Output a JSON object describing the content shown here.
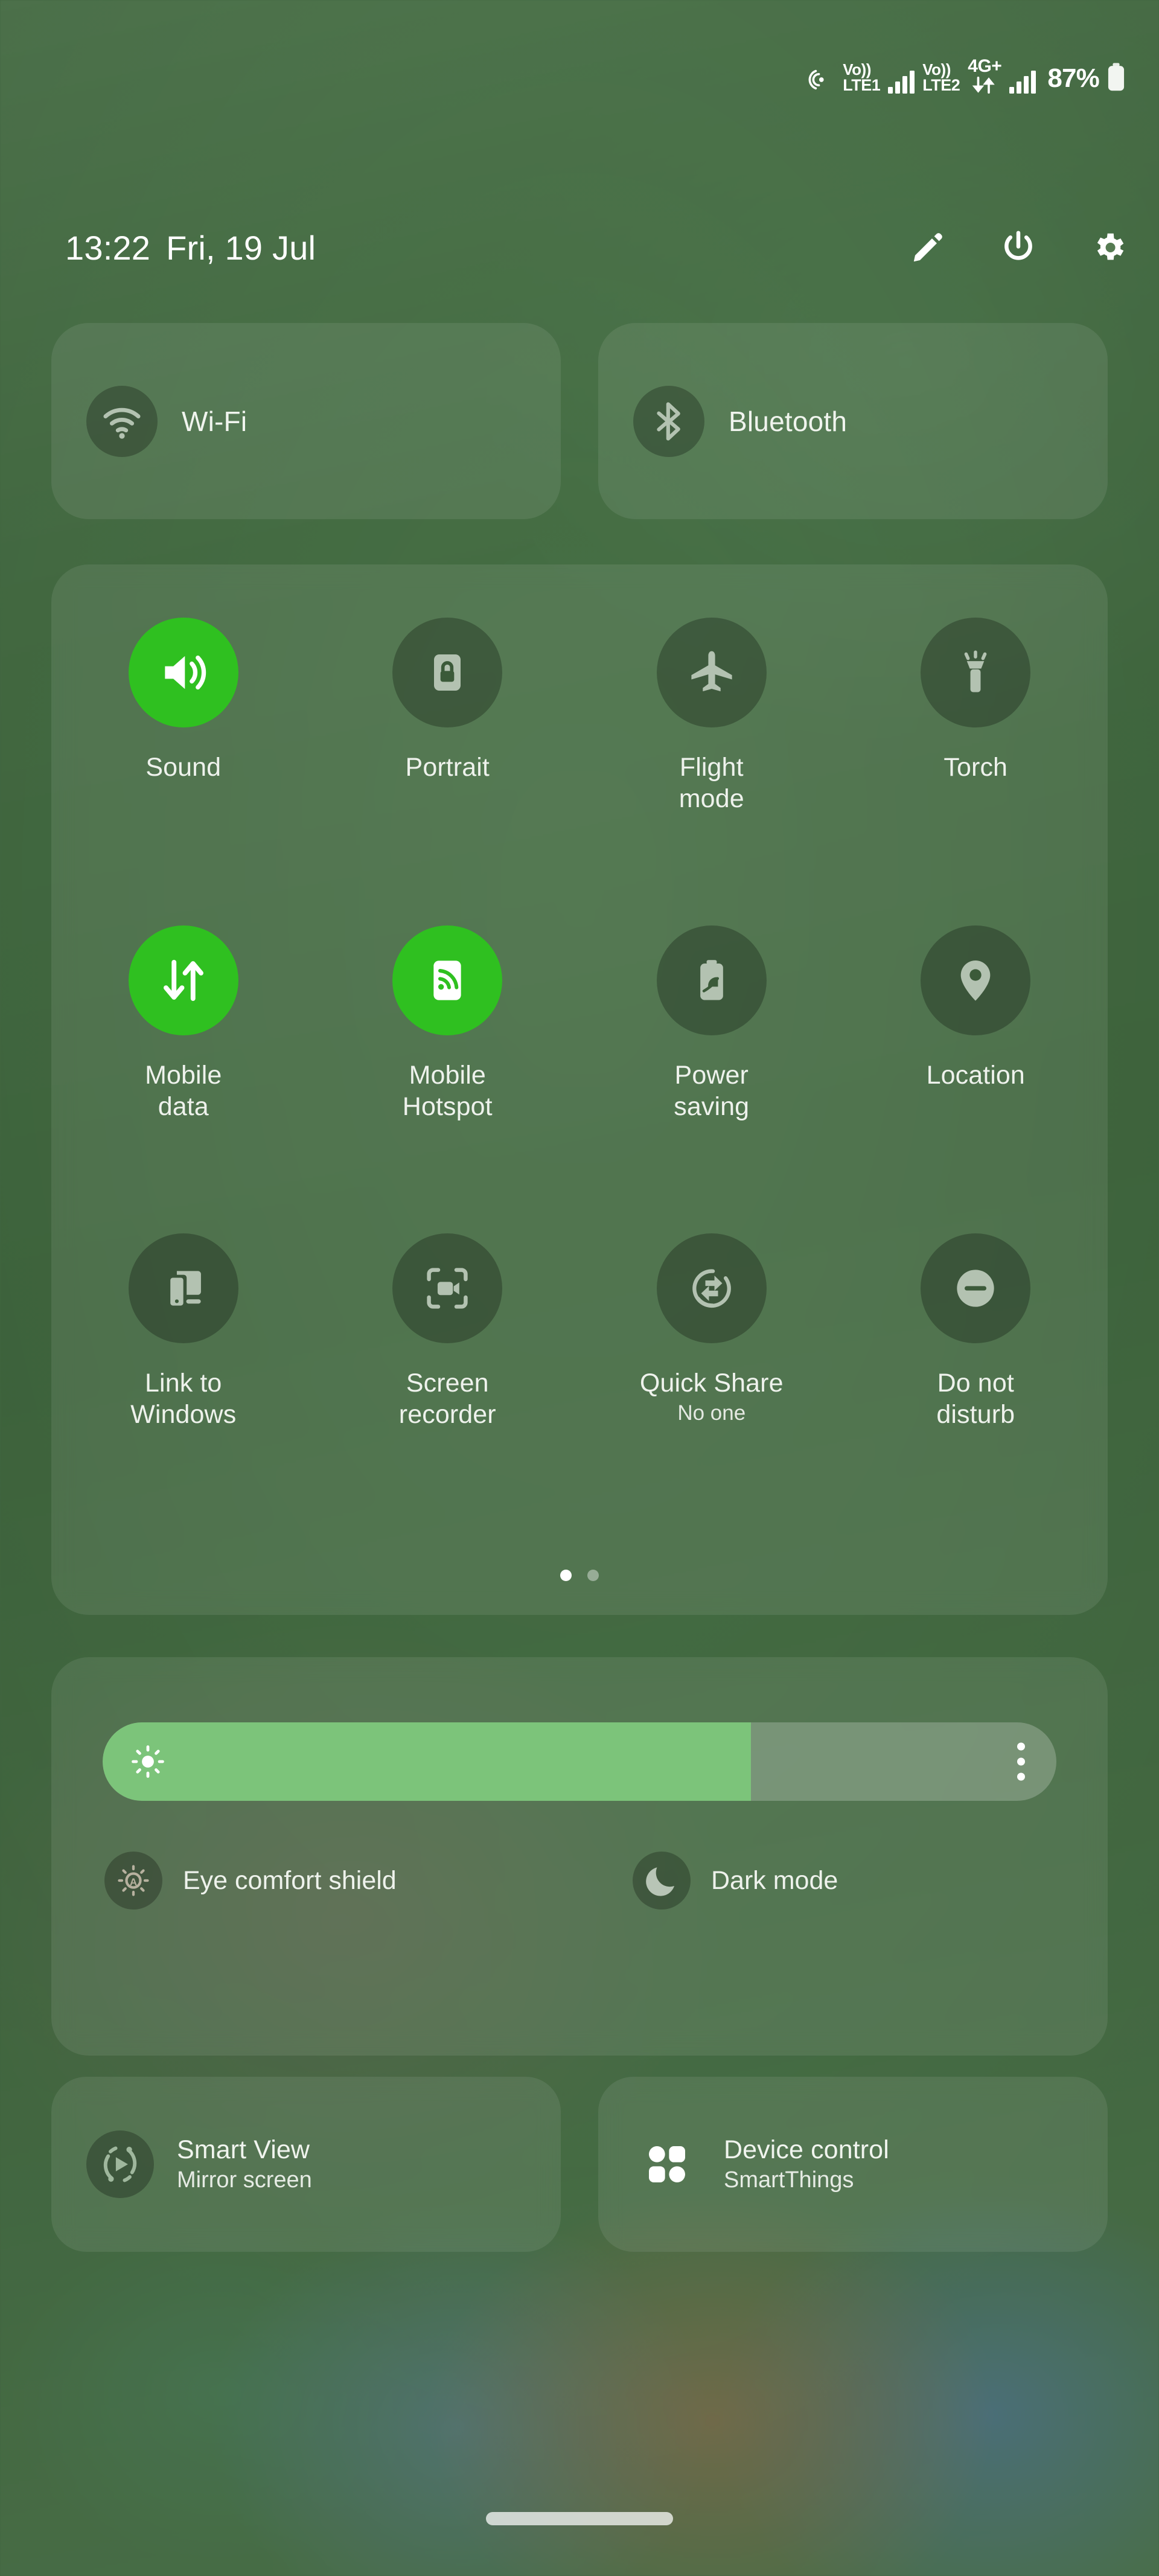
{
  "status_bar": {
    "hotspot_icon": "hotspot-icon",
    "sim1": {
      "volte_top": "Vo))",
      "volte_bottom": "LTE1",
      "signal_icon": "signal-bars-icon"
    },
    "sim2": {
      "volte_top": "Vo))",
      "volte_bottom": "LTE2",
      "network": "4G+",
      "data_arrows_icon": "data-transfer-icon",
      "signal_icon": "signal-bars-icon"
    },
    "battery_percent": "87%",
    "battery_icon": "battery-icon"
  },
  "header": {
    "time": "13:22",
    "date": "Fri, 19 Jul",
    "icons": [
      {
        "name": "edit-icon",
        "label": "Edit"
      },
      {
        "name": "power-icon",
        "label": "Power"
      },
      {
        "name": "settings-gear-icon",
        "label": "Settings"
      }
    ]
  },
  "top_tiles": [
    {
      "label": "Wi-Fi",
      "icon": "wifi-icon",
      "active": false
    },
    {
      "label": "Bluetooth",
      "icon": "bluetooth-icon",
      "active": false
    }
  ],
  "quick_toggles": [
    {
      "label": "Sound",
      "icon": "volume-on-icon",
      "active": true,
      "sub": ""
    },
    {
      "label": "Portrait",
      "icon": "rotation-lock-icon",
      "active": false,
      "sub": ""
    },
    {
      "label": "Flight\nmode",
      "icon": "airplane-icon",
      "active": false,
      "sub": ""
    },
    {
      "label": "Torch",
      "icon": "flashlight-icon",
      "active": false,
      "sub": ""
    },
    {
      "label": "Mobile\ndata",
      "icon": "mobile-data-icon",
      "active": true,
      "sub": ""
    },
    {
      "label": "Mobile\nHotspot",
      "icon": "hotspot-device-icon",
      "active": true,
      "sub": ""
    },
    {
      "label": "Power\nsaving",
      "icon": "battery-leaf-icon",
      "active": false,
      "sub": ""
    },
    {
      "label": "Location",
      "icon": "location-pin-icon",
      "active": false,
      "sub": ""
    },
    {
      "label": "Link to\nWindows",
      "icon": "link-to-windows-icon",
      "active": false,
      "sub": ""
    },
    {
      "label": "Screen\nrecorder",
      "icon": "screen-recorder-icon",
      "active": false,
      "sub": ""
    },
    {
      "label": "Quick Share",
      "icon": "quick-share-icon",
      "active": false,
      "sub": "No one"
    },
    {
      "label": "Do not\ndisturb",
      "icon": "do-not-disturb-icon",
      "active": false,
      "sub": ""
    }
  ],
  "pagination": {
    "pages": 2,
    "active_page": 1
  },
  "brightness": {
    "icon": "brightness-sun-icon",
    "level_percent": 68,
    "menu_icon": "more-options-icon"
  },
  "display_modes": [
    {
      "label": "Eye comfort shield",
      "icon": "eye-comfort-icon",
      "active": false
    },
    {
      "label": "Dark mode",
      "icon": "moon-icon",
      "active": false
    }
  ],
  "bottom_cards": [
    {
      "title": "Smart View",
      "subtitle": "Mirror screen",
      "icon": "smart-view-icon"
    },
    {
      "title": "Device control",
      "subtitle": "SmartThings",
      "icon": "device-grid-icon"
    }
  ],
  "navigation": {
    "handle_icon": "home-gesture-handle"
  },
  "colors": {
    "accent_on": "#2fc020",
    "slider_fill": "#7cc47a",
    "text_primary": "#f0f4ee",
    "panel_bg": "rgba(255,255,255,0.085)"
  }
}
